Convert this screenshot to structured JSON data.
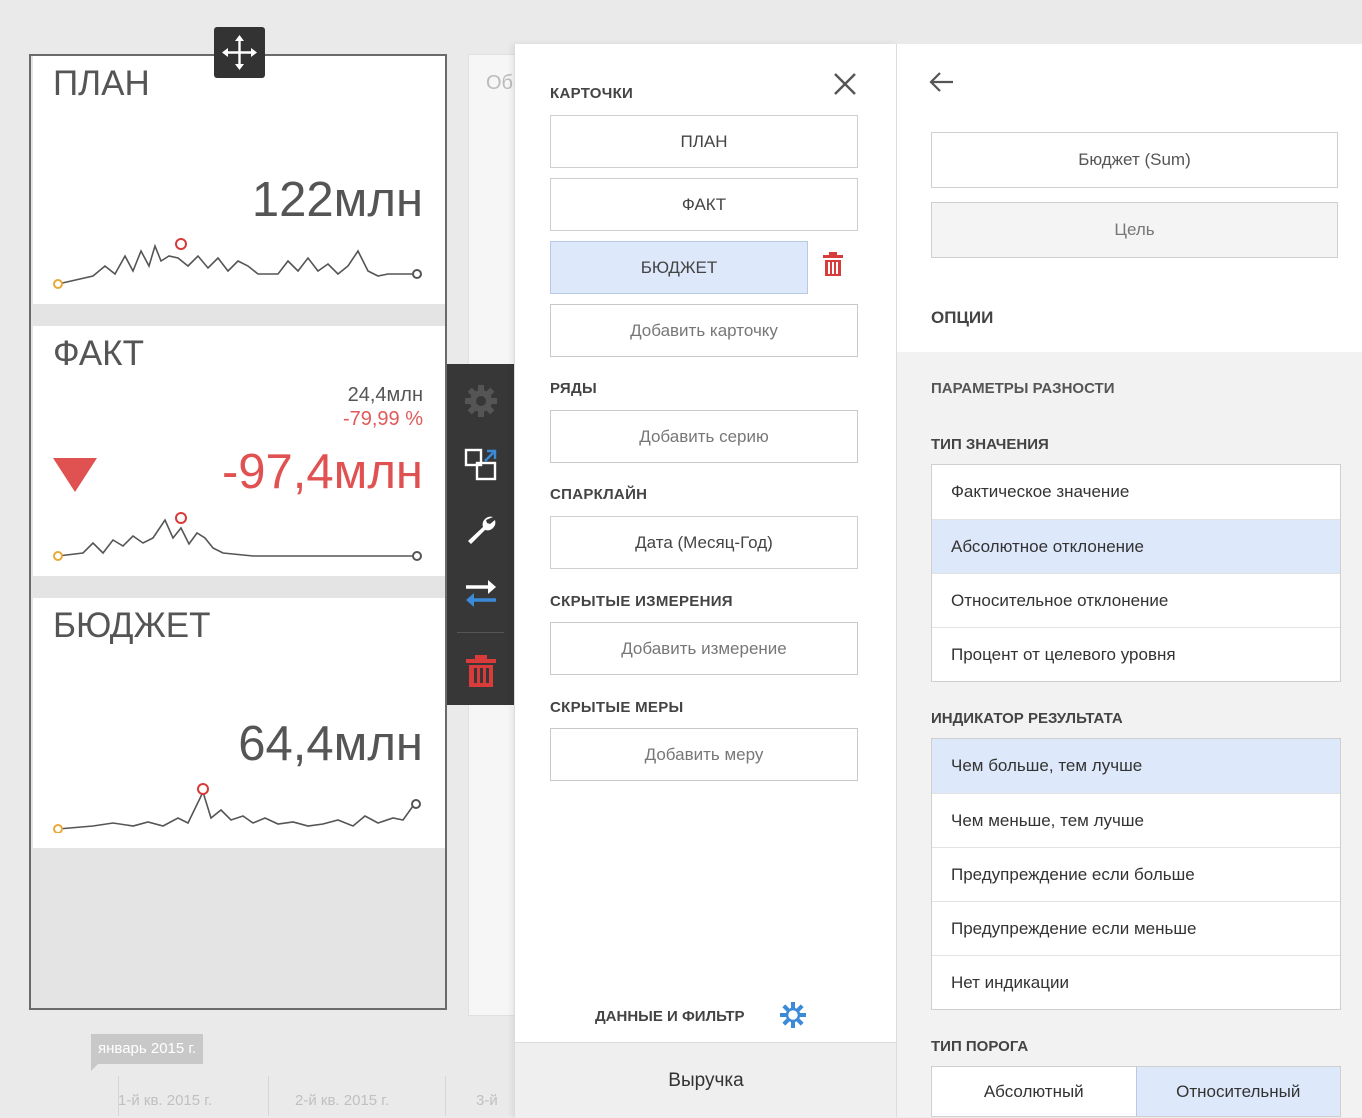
{
  "background": {
    "hidden_panel_text": "Об"
  },
  "cards": [
    {
      "title": "ПЛАН",
      "main_value": "122млн"
    },
    {
      "title": "ФАКТ",
      "target_value": "24,4млн",
      "delta_percent": "-79,99 %",
      "main_value": "-97,4млн",
      "indicator": "down-triangle",
      "indicator_color": "#e05252"
    },
    {
      "title": "БЮДЖЕТ",
      "main_value": "64,4млн"
    }
  ],
  "colors": {
    "accent_blue": "#3b8ad8",
    "selected_bg": "#dde9fb",
    "danger_red": "#d93a3a",
    "sparkline_start": "#e8a93a",
    "sparkline_peak": "#d83a3a"
  },
  "toolbar": {
    "items": [
      "gear-icon",
      "convert-icon",
      "wrench-icon",
      "swap-icon",
      "trash-icon"
    ]
  },
  "timeline": {
    "selected": "январь 2015 г.",
    "quarters": [
      "1-й кв. 2015 г.",
      "2-й кв. 2015 г.",
      "3-й"
    ]
  },
  "binding_panel": {
    "cards_label": "КАРТОЧКИ",
    "cards": [
      "ПЛАН",
      "ФАКТ",
      "БЮДЖЕТ"
    ],
    "add_card": "Добавить карточку",
    "series_label": "РЯДЫ",
    "add_series": "Добавить серию",
    "sparkline_label": "СПАРКЛАЙН",
    "sparkline_value": "Дата (Месяц-Год)",
    "hidden_dims_label": "СКРЫТЫЕ ИЗМЕРЕНИЯ",
    "add_dimension": "Добавить измерение",
    "hidden_measures_label": "СКРЫТЫЕ МЕРЫ",
    "add_measure": "Добавить меру",
    "data_filter": "ДАННЫЕ И ФИЛЬТР",
    "footer": "Выручка"
  },
  "options_panel": {
    "actual_field": "Бюджет (Sum)",
    "target_field": "Цель",
    "options_label": "ОПЦИИ",
    "delta_params_label": "ПАРАМЕТРЫ РАЗНОСТИ",
    "value_type_label": "ТИП ЗНАЧЕНИЯ",
    "value_types": [
      "Фактическое значение",
      "Абсолютное отклонение",
      "Относительное отклонение",
      "Процент от целевого уровня"
    ],
    "value_type_selected": "Абсолютное отклонение",
    "result_indicator_label": "ИНДИКАТОР РЕЗУЛЬТАТА",
    "result_indicators": [
      "Чем больше, тем лучше",
      "Чем меньше, тем лучше",
      "Предупреждение если больше",
      "Предупреждение если меньше",
      "Нет индикации"
    ],
    "result_indicator_selected": "Чем больше, тем лучше",
    "threshold_type_label": "ТИП ПОРОГА",
    "threshold_types": [
      "Абсолютный",
      "Относительный"
    ],
    "threshold_type_selected": "Относительный"
  }
}
